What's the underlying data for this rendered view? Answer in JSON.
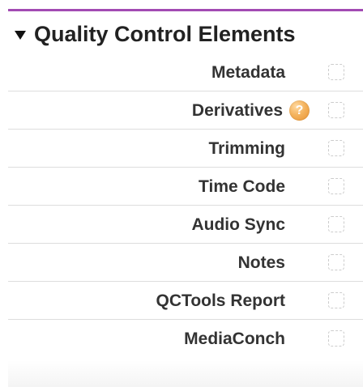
{
  "colors": {
    "accent": "#a24bb3",
    "help_icon": "#f4b35e",
    "text": "#333333"
  },
  "section": {
    "title": "Quality Control Elements",
    "expanded": true
  },
  "items": [
    {
      "label": "Metadata",
      "checked": false,
      "has_help_icon": false
    },
    {
      "label": "Derivatives",
      "checked": false,
      "has_help_icon": true
    },
    {
      "label": "Trimming",
      "checked": false,
      "has_help_icon": false
    },
    {
      "label": "Time Code",
      "checked": false,
      "has_help_icon": false
    },
    {
      "label": "Audio Sync",
      "checked": false,
      "has_help_icon": false
    },
    {
      "label": "Notes",
      "checked": false,
      "has_help_icon": false
    },
    {
      "label": "QCTools Report",
      "checked": false,
      "has_help_icon": false
    },
    {
      "label": "MediaConch",
      "checked": false,
      "has_help_icon": false
    }
  ],
  "help_icon": {
    "symbol": "?",
    "icon_name": "help-icon"
  }
}
